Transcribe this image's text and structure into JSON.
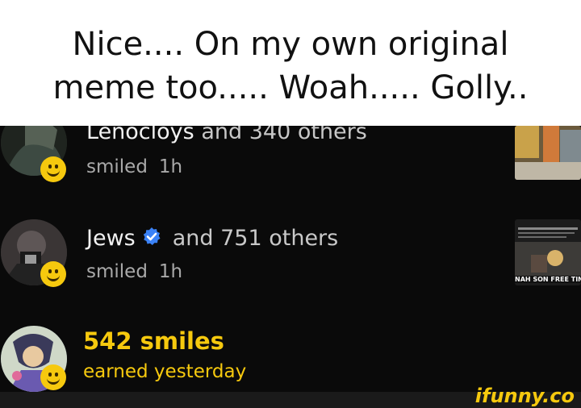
{
  "caption": {
    "line1": "Nice.... On my own original",
    "line2": "meme too..... Woah..... Golly.."
  },
  "notifications": [
    {
      "name": "Lenocloys",
      "others_text": "and 340 others",
      "action": "smiled",
      "time": "1h",
      "avatar_icon": "anime-avatar",
      "badge_icon": "smile-emoji-icon"
    },
    {
      "name": "Jews",
      "verified": true,
      "others_text": "and 751 others",
      "action": "smiled",
      "time": "1h",
      "avatar_icon": "photo-avatar",
      "badge_icon": "smile-emoji-icon",
      "thumb_text": "NAH SON FREE TIN FO"
    },
    {
      "smiles_count": "542 smiles",
      "earned_text": "earned yesterday",
      "avatar_icon": "anime-avatar",
      "badge_icon": "smile-emoji-icon"
    }
  ],
  "watermark": "ifunny.co",
  "colors": {
    "accent": "#f6c90e",
    "background": "#0a0a0a",
    "verified_blue": "#3b82f6"
  }
}
